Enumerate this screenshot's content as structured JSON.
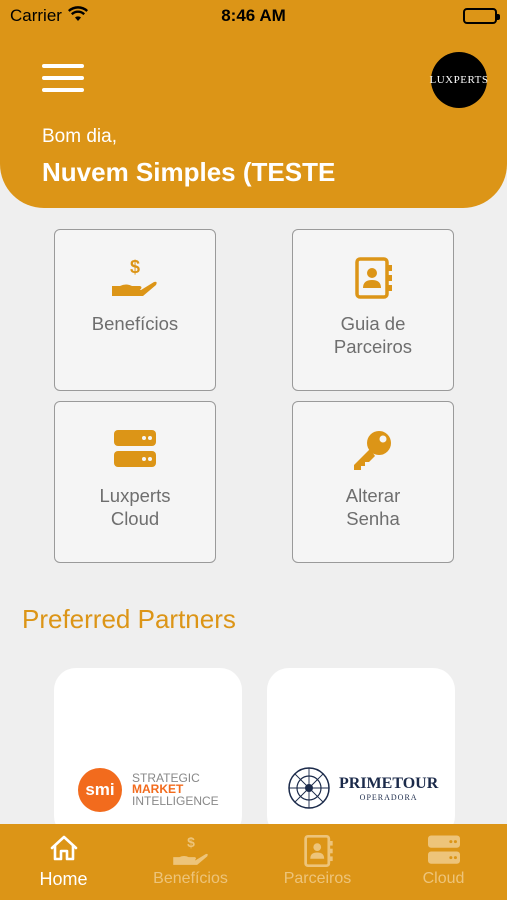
{
  "status_bar": {
    "carrier": "Carrier",
    "time": "8:46 AM"
  },
  "header": {
    "logo_text": "LUXPERTS",
    "greeting": "Bom dia,",
    "user_name": "Nuvem Simples (TESTE"
  },
  "tiles": [
    {
      "label": "Benefícios",
      "icon": "hand-dollar-icon"
    },
    {
      "label": "Guia de\nParceiros",
      "icon": "contact-book-icon"
    },
    {
      "label": "Luxperts\nCloud",
      "icon": "server-icon"
    },
    {
      "label": "Alterar\nSenha",
      "icon": "key-icon"
    }
  ],
  "partners_section": {
    "title": "Preferred Partners",
    "partners": [
      {
        "circle": "smi",
        "line1": "STRATEGIC",
        "line2": "MARKET",
        "line3": "INTELLIGENCE"
      },
      {
        "name": "PRIMETOUR",
        "sub": "OPERADORA"
      }
    ]
  },
  "tab_bar": [
    {
      "label": "Home",
      "icon": "home-icon",
      "active": true
    },
    {
      "label": "Benefícios",
      "icon": "hand-dollar-icon",
      "active": false
    },
    {
      "label": "Parceiros",
      "icon": "contact-book-icon",
      "active": false
    },
    {
      "label": "Cloud",
      "icon": "server-icon",
      "active": false
    }
  ],
  "colors": {
    "accent": "#dc9517",
    "inactive_tab": "#edc47a",
    "smi_orange": "#f26b1d"
  }
}
